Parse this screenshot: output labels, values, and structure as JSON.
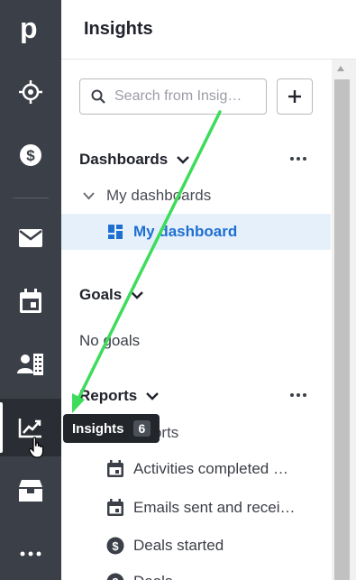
{
  "rail": {
    "items": [
      {
        "name": "logo",
        "glyph": "p"
      },
      {
        "name": "leads",
        "icon": "target-icon"
      },
      {
        "name": "deals",
        "icon": "dollar-icon"
      },
      {
        "name": "mail",
        "icon": "mail-icon"
      },
      {
        "name": "activities",
        "icon": "calendar-icon"
      },
      {
        "name": "contacts",
        "icon": "contacts-icon"
      },
      {
        "name": "insights",
        "icon": "chart-icon"
      },
      {
        "name": "products",
        "icon": "box-icon"
      },
      {
        "name": "more",
        "icon": "more-icon"
      }
    ]
  },
  "header": {
    "title": "Insights"
  },
  "search": {
    "placeholder": "Search from Insig…"
  },
  "dashboards": {
    "label": "Dashboards",
    "group_label": "My dashboards",
    "selected_item": "My dashboard"
  },
  "goals": {
    "label": "Goals",
    "empty_text": "No goals"
  },
  "reports": {
    "label": "Reports",
    "group_label": "My reports",
    "items": [
      {
        "label": "Activities completed …",
        "icon": "calendar-icon"
      },
      {
        "label": "Emails sent and recei…",
        "icon": "calendar-icon"
      },
      {
        "label": "Deals started",
        "icon": "dollar-icon"
      },
      {
        "label": "Deals…",
        "icon": "dollar-icon"
      }
    ]
  },
  "tooltip": {
    "label": "Insights",
    "count": "6"
  },
  "colors": {
    "rail_bg": "#3b3f47",
    "selected_bg": "#e5f0fb",
    "selected_text": "#1f6fd1",
    "arrow": "#3ddc5a"
  }
}
